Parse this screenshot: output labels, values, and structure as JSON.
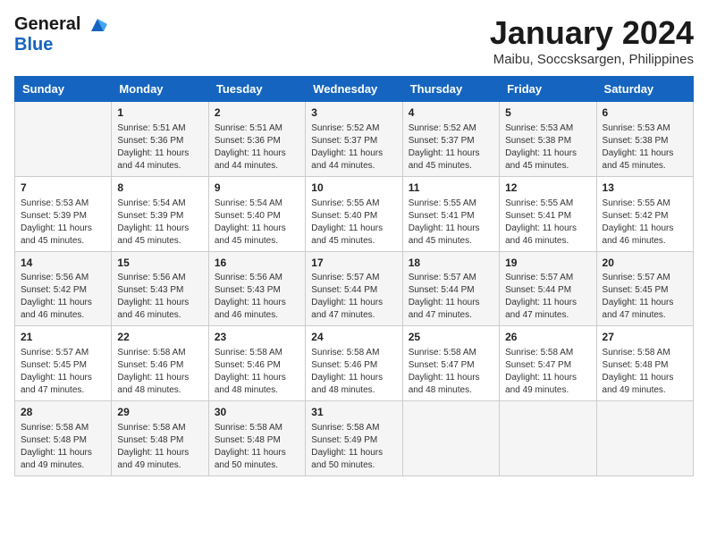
{
  "logo": {
    "line1": "General",
    "line2": "Blue"
  },
  "title": "January 2024",
  "location": "Maibu, Soccsksargen, Philippines",
  "days_header": [
    "Sunday",
    "Monday",
    "Tuesday",
    "Wednesday",
    "Thursday",
    "Friday",
    "Saturday"
  ],
  "weeks": [
    [
      {
        "day": "",
        "info": ""
      },
      {
        "day": "1",
        "info": "Sunrise: 5:51 AM\nSunset: 5:36 PM\nDaylight: 11 hours\nand 44 minutes."
      },
      {
        "day": "2",
        "info": "Sunrise: 5:51 AM\nSunset: 5:36 PM\nDaylight: 11 hours\nand 44 minutes."
      },
      {
        "day": "3",
        "info": "Sunrise: 5:52 AM\nSunset: 5:37 PM\nDaylight: 11 hours\nand 44 minutes."
      },
      {
        "day": "4",
        "info": "Sunrise: 5:52 AM\nSunset: 5:37 PM\nDaylight: 11 hours\nand 45 minutes."
      },
      {
        "day": "5",
        "info": "Sunrise: 5:53 AM\nSunset: 5:38 PM\nDaylight: 11 hours\nand 45 minutes."
      },
      {
        "day": "6",
        "info": "Sunrise: 5:53 AM\nSunset: 5:38 PM\nDaylight: 11 hours\nand 45 minutes."
      }
    ],
    [
      {
        "day": "7",
        "info": "Sunrise: 5:53 AM\nSunset: 5:39 PM\nDaylight: 11 hours\nand 45 minutes."
      },
      {
        "day": "8",
        "info": "Sunrise: 5:54 AM\nSunset: 5:39 PM\nDaylight: 11 hours\nand 45 minutes."
      },
      {
        "day": "9",
        "info": "Sunrise: 5:54 AM\nSunset: 5:40 PM\nDaylight: 11 hours\nand 45 minutes."
      },
      {
        "day": "10",
        "info": "Sunrise: 5:55 AM\nSunset: 5:40 PM\nDaylight: 11 hours\nand 45 minutes."
      },
      {
        "day": "11",
        "info": "Sunrise: 5:55 AM\nSunset: 5:41 PM\nDaylight: 11 hours\nand 45 minutes."
      },
      {
        "day": "12",
        "info": "Sunrise: 5:55 AM\nSunset: 5:41 PM\nDaylight: 11 hours\nand 46 minutes."
      },
      {
        "day": "13",
        "info": "Sunrise: 5:55 AM\nSunset: 5:42 PM\nDaylight: 11 hours\nand 46 minutes."
      }
    ],
    [
      {
        "day": "14",
        "info": "Sunrise: 5:56 AM\nSunset: 5:42 PM\nDaylight: 11 hours\nand 46 minutes."
      },
      {
        "day": "15",
        "info": "Sunrise: 5:56 AM\nSunset: 5:43 PM\nDaylight: 11 hours\nand 46 minutes."
      },
      {
        "day": "16",
        "info": "Sunrise: 5:56 AM\nSunset: 5:43 PM\nDaylight: 11 hours\nand 46 minutes."
      },
      {
        "day": "17",
        "info": "Sunrise: 5:57 AM\nSunset: 5:44 PM\nDaylight: 11 hours\nand 47 minutes."
      },
      {
        "day": "18",
        "info": "Sunrise: 5:57 AM\nSunset: 5:44 PM\nDaylight: 11 hours\nand 47 minutes."
      },
      {
        "day": "19",
        "info": "Sunrise: 5:57 AM\nSunset: 5:44 PM\nDaylight: 11 hours\nand 47 minutes."
      },
      {
        "day": "20",
        "info": "Sunrise: 5:57 AM\nSunset: 5:45 PM\nDaylight: 11 hours\nand 47 minutes."
      }
    ],
    [
      {
        "day": "21",
        "info": "Sunrise: 5:57 AM\nSunset: 5:45 PM\nDaylight: 11 hours\nand 47 minutes."
      },
      {
        "day": "22",
        "info": "Sunrise: 5:58 AM\nSunset: 5:46 PM\nDaylight: 11 hours\nand 48 minutes."
      },
      {
        "day": "23",
        "info": "Sunrise: 5:58 AM\nSunset: 5:46 PM\nDaylight: 11 hours\nand 48 minutes."
      },
      {
        "day": "24",
        "info": "Sunrise: 5:58 AM\nSunset: 5:46 PM\nDaylight: 11 hours\nand 48 minutes."
      },
      {
        "day": "25",
        "info": "Sunrise: 5:58 AM\nSunset: 5:47 PM\nDaylight: 11 hours\nand 48 minutes."
      },
      {
        "day": "26",
        "info": "Sunrise: 5:58 AM\nSunset: 5:47 PM\nDaylight: 11 hours\nand 49 minutes."
      },
      {
        "day": "27",
        "info": "Sunrise: 5:58 AM\nSunset: 5:48 PM\nDaylight: 11 hours\nand 49 minutes."
      }
    ],
    [
      {
        "day": "28",
        "info": "Sunrise: 5:58 AM\nSunset: 5:48 PM\nDaylight: 11 hours\nand 49 minutes."
      },
      {
        "day": "29",
        "info": "Sunrise: 5:58 AM\nSunset: 5:48 PM\nDaylight: 11 hours\nand 49 minutes."
      },
      {
        "day": "30",
        "info": "Sunrise: 5:58 AM\nSunset: 5:48 PM\nDaylight: 11 hours\nand 50 minutes."
      },
      {
        "day": "31",
        "info": "Sunrise: 5:58 AM\nSunset: 5:49 PM\nDaylight: 11 hours\nand 50 minutes."
      },
      {
        "day": "",
        "info": ""
      },
      {
        "day": "",
        "info": ""
      },
      {
        "day": "",
        "info": ""
      }
    ]
  ]
}
